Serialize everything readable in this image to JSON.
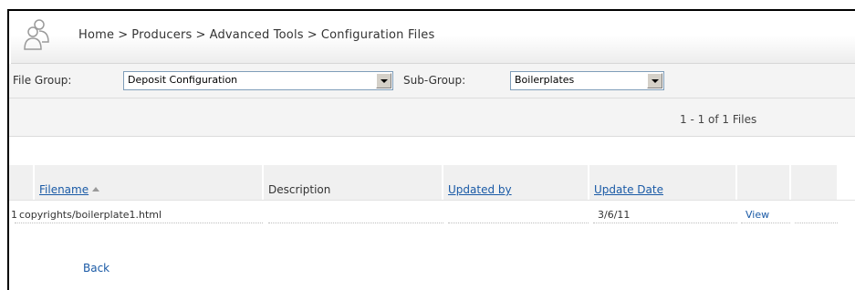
{
  "breadcrumb": {
    "items": [
      "Home",
      "Producers",
      "Advanced Tools",
      "Configuration Files"
    ],
    "separator": ">"
  },
  "filters": {
    "file_group_label": "File Group:",
    "file_group_value": "Deposit Configuration",
    "sub_group_label": "Sub-Group:",
    "sub_group_value": "Boilerplates"
  },
  "pagination": {
    "info": "1 - 1 of 1 Files"
  },
  "table": {
    "columns": [
      "Filename",
      "Description",
      "Updated by",
      "Update Date"
    ],
    "sorted_column": "Filename",
    "rows": [
      {
        "index": "1",
        "filename": "copyrights/boilerplate1.html",
        "description": "",
        "updated_by": "",
        "update_date": "3/6/11",
        "action": "View"
      }
    ]
  },
  "back_link": "Back",
  "colors": {
    "link": "#1a5aa6",
    "header_bg": "#f0f0f0",
    "border": "#000000"
  },
  "icons": {
    "logo": "users-group-icon",
    "dropdown": "chevron-down-icon",
    "sort": "sort-ascending-icon"
  }
}
